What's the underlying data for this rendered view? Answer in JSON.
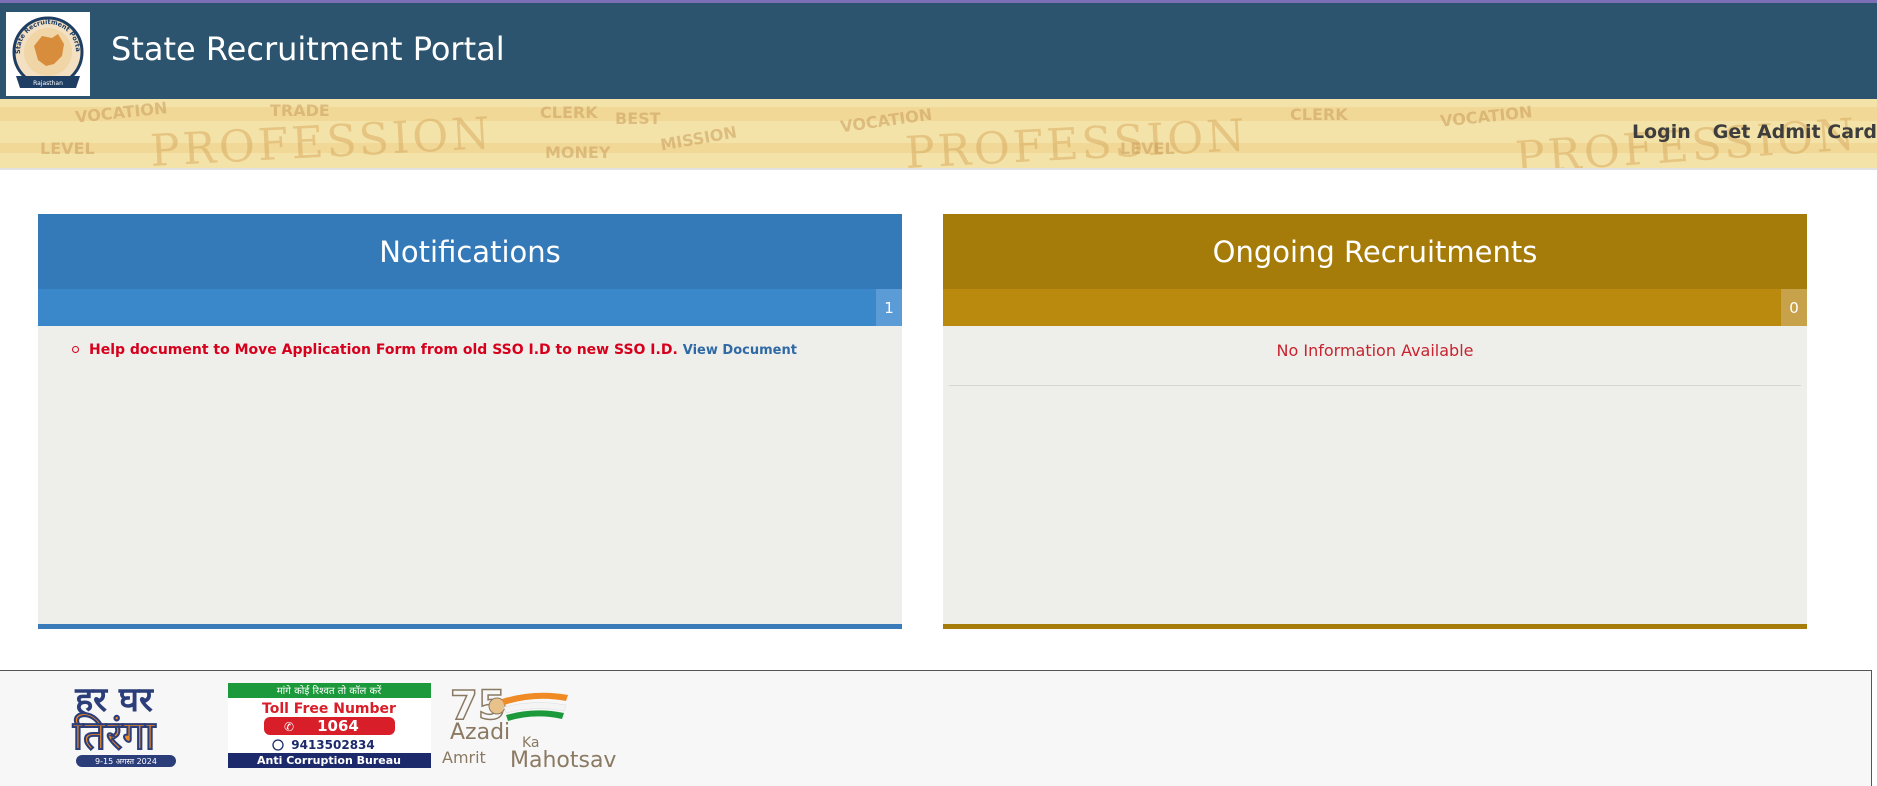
{
  "header": {
    "title": "State Recruitment Portal",
    "logo": {
      "top_text": "State Recruitment Portal",
      "bottom_text": "Rajasthan"
    }
  },
  "banner": {
    "watermarks": [
      "PROFESSION",
      "VOCATION",
      "CLERK",
      "MONEY",
      "MISSION",
      "TRADE",
      "LEVEL",
      "BEST"
    ]
  },
  "nav": {
    "login": "Login",
    "admit_card": "Get Admit Card"
  },
  "notifications": {
    "title": "Notifications",
    "count": "1",
    "items": [
      {
        "text": "Help document to Move Application Form from old SSO I.D to new SSO I.D.",
        "link": "View Document"
      }
    ]
  },
  "recruitments": {
    "title": "Ongoing Recruitments",
    "count": "0",
    "empty_text": "No Information Available"
  },
  "footer": {
    "tiranga": {
      "line1": "हर घर",
      "line2": "तिरंगा",
      "dates": "9-15 अगस्त 2024"
    },
    "acb": {
      "tagline": "मांगे कोई रिश्वत तो कॉल करें",
      "toll_label": "Toll Free Number",
      "toll_number": "1064",
      "whatsapp": "9413502834",
      "bureau": "Anti Corruption Bureau"
    },
    "azadi": {
      "number": "75",
      "word1": "Azadi",
      "word2": "Ka",
      "word3": "Amrit",
      "word4": "Mahotsav"
    }
  },
  "colors": {
    "header_bg": "#2d546f",
    "notifications_accent": "#357ab8",
    "recruitments_accent": "#a57b09",
    "alert_text": "#d6001c"
  }
}
